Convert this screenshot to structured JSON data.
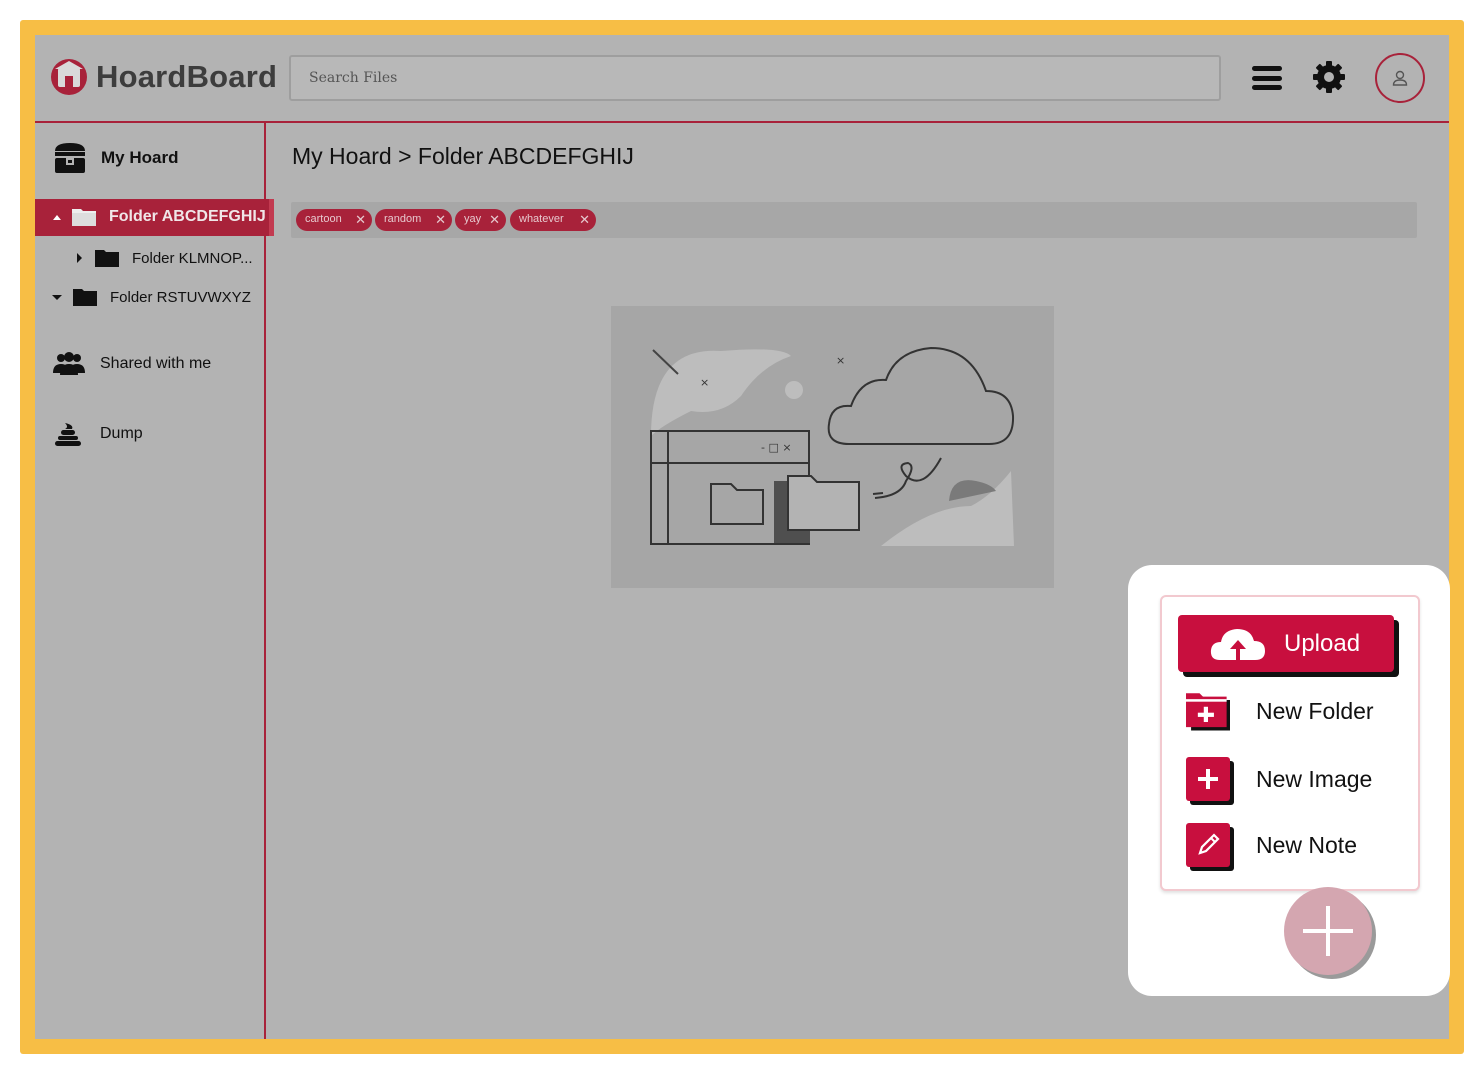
{
  "app": {
    "brand": "HoardBoard"
  },
  "header": {
    "search_placeholder": "Search Files",
    "icons": [
      "hoardboard-logo",
      "hamburger-menu-icon",
      "gear-icon",
      "user-icon"
    ]
  },
  "sidebar": {
    "my_hoard": "My Hoard",
    "folders": [
      {
        "label": "Folder ABCDEFGHIJ",
        "expanded": true,
        "selected": true
      },
      {
        "label": "Folder KLMNOP...",
        "expanded": false
      },
      {
        "label": "Folder RSTUVWXYZ",
        "expanded": true
      }
    ],
    "shared": "Shared with me",
    "dump": "Dump"
  },
  "main": {
    "breadcrumb": "My Hoard > Folder ABCDEFGHIJ",
    "tags": [
      {
        "label": "cartoon"
      },
      {
        "label": "random"
      },
      {
        "label": "yay"
      },
      {
        "label": "whatever"
      }
    ],
    "illustration": "empty-folder-cloud-illustration"
  },
  "popup": {
    "upload": "Upload",
    "new_folder": "New Folder",
    "new_image": "New Image",
    "new_note": "New Note"
  },
  "colors": {
    "accent": "#a8223a",
    "primary": "#c80f3e",
    "frame": "#f7be45",
    "overlay": "#b3b3b3"
  }
}
